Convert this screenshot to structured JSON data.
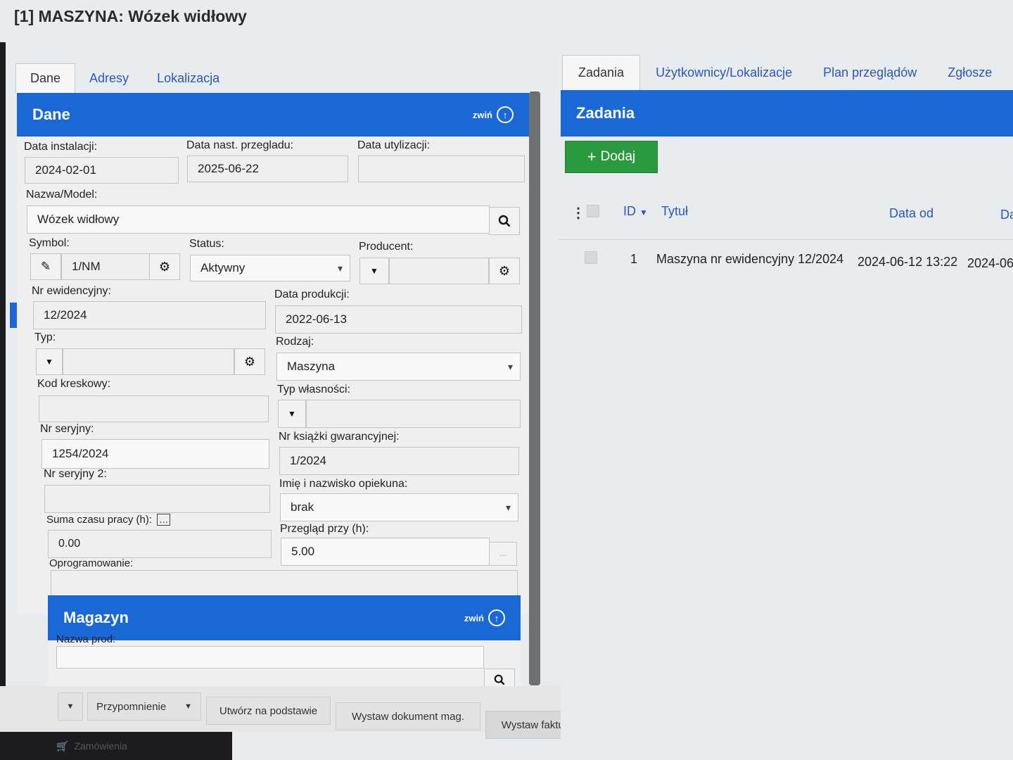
{
  "window": {
    "title": "[1] MASZYNA: Wózek widłowy"
  },
  "left": {
    "tabs": [
      {
        "label": "Dane",
        "active": true
      },
      {
        "label": "Adresy",
        "active": false
      },
      {
        "label": "Lokalizacja",
        "active": false
      }
    ],
    "panel_title": "Dane",
    "collapse_label": "zwiń",
    "fields": {
      "install_date": {
        "label": "Data instalacji:",
        "value": "2024-02-01"
      },
      "next_review": {
        "label": "Data nast. przegladu:",
        "value": "2025-06-22"
      },
      "disposal_date": {
        "label": "Data utylizacji:",
        "value": ""
      },
      "name_model": {
        "label": "Nazwa/Model:",
        "value": "Wózek widłowy"
      },
      "symbol": {
        "label": "Symbol:",
        "value": "1/NM"
      },
      "status": {
        "label": "Status:",
        "value": "Aktywny"
      },
      "producer": {
        "label": "Producent:",
        "value": ""
      },
      "inventory_no": {
        "label": "Nr ewidencyjny:",
        "value": "12/2024"
      },
      "production_date": {
        "label": "Data produkcji:",
        "value": "2022-06-13"
      },
      "type": {
        "label": "Typ:",
        "value": ""
      },
      "kind": {
        "label": "Rodzaj:",
        "value": "Maszyna"
      },
      "barcode": {
        "label": "Kod kreskowy:",
        "value": ""
      },
      "ownership": {
        "label": "Typ własności:",
        "value": ""
      },
      "serial": {
        "label": "Nr seryjny:",
        "value": "1254/2024"
      },
      "warranty": {
        "label": "Nr książki gwarancyjnej:",
        "value": "1/2024"
      },
      "serial2": {
        "label": "Nr seryjny 2:",
        "value": ""
      },
      "caretaker": {
        "label": "Imię i nazwisko opiekuna:",
        "value": "brak"
      },
      "work_hours": {
        "label": "Suma czasu pracy (h):",
        "value": "0.00"
      },
      "review_at": {
        "label": "Przegląd przy (h):",
        "value": "5.00"
      },
      "software": {
        "label": "Oprogramowanie:",
        "value": ""
      }
    },
    "magazyn": {
      "title": "Magazyn",
      "collapse_label": "zwiń",
      "product_name": {
        "label": "Nazwa prod:",
        "value": ""
      }
    },
    "bottom_buttons": {
      "reminder": "Przypomnienie",
      "create_from": "Utwórz na podstawie",
      "issue_doc": "Wystaw dokument mag.",
      "issue_invoice": "Wystaw fakturę"
    },
    "taskbar": {
      "orders_label": "Zamówienia"
    }
  },
  "right": {
    "tabs": [
      {
        "label": "Zadania",
        "active": true
      },
      {
        "label": "Użytkownicy/Lokalizacje",
        "active": false
      },
      {
        "label": "Plan przeglądów",
        "active": false
      },
      {
        "label": "Zgłosze",
        "active": false
      }
    ],
    "panel_title": "Zadania",
    "add_button": "Dodaj",
    "columns": [
      "ID",
      "Tytuł",
      "Data od",
      "Da"
    ],
    "rows": [
      {
        "id": "1",
        "title": "Maszyna nr ewidencyjny 12/2024",
        "date_from": "2024-06-12 13:22",
        "date_to": "2024-06"
      }
    ]
  },
  "colors": {
    "header_blue": "#1a68d6",
    "add_green": "#2a9a3e",
    "link_blue": "#2a55c8"
  },
  "icons": [
    "arrow-up-circle-icon",
    "search-icon",
    "pencil-icon",
    "gear-icon",
    "chevron-down-icon",
    "plus-icon",
    "kebab-menu-icon",
    "comment-icon",
    "cart-icon",
    "hand-cursor-icon"
  ]
}
